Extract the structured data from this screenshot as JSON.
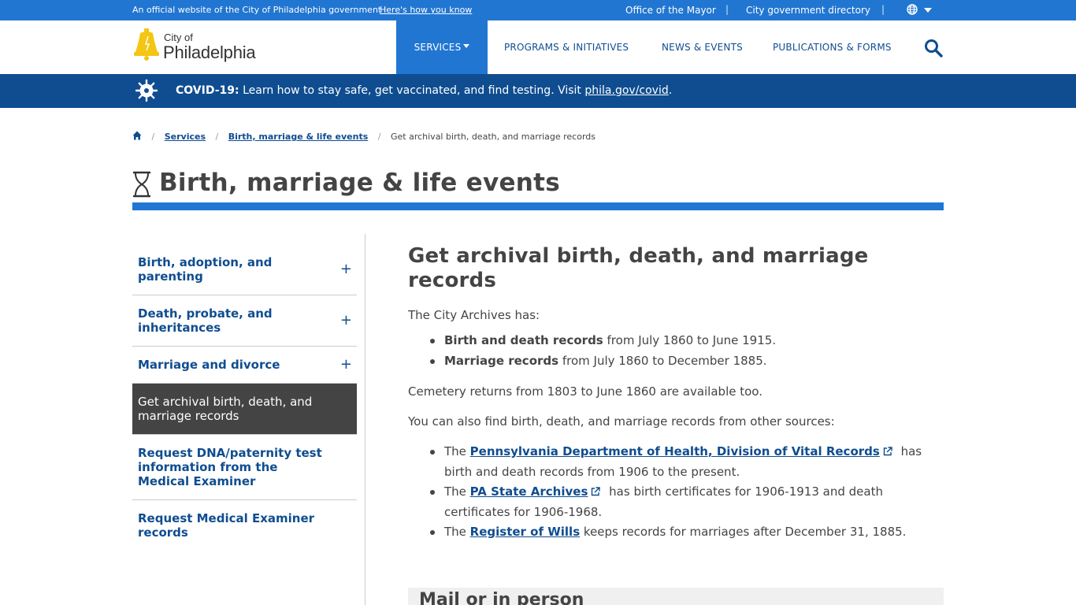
{
  "topbar": {
    "official_text": "An official website of the City of Philadelphia government",
    "how_know": "Here's how you know",
    "links": [
      "Office of the Mayor",
      "City government directory"
    ]
  },
  "header": {
    "logo_city_of": "City of",
    "logo_name": "Philadelphia",
    "nav": [
      "Services",
      "Programs & Initiatives",
      "News & Events",
      "Publications & Forms"
    ]
  },
  "covid": {
    "label": "COVID-19:",
    "message": " Learn how to stay safe, get vaccinated, and find testing. Visit ",
    "link": "phila.gov/covid",
    "end": "."
  },
  "breadcrumb": {
    "items": [
      "Services",
      "Birth, marriage & life events"
    ],
    "current": "Get archival birth, death, and marriage records"
  },
  "page_title": "Birth, marriage & life events",
  "sidenav": [
    {
      "label": "Birth, adoption, and parenting",
      "expandable": true
    },
    {
      "label": "Death, probate, and inheritances",
      "expandable": true
    },
    {
      "label": "Marriage and divorce",
      "expandable": true
    },
    {
      "label": "Get archival birth, death, and marriage records",
      "active": true
    },
    {
      "label": "Request DNA/paternity test information from the Medical Examiner"
    },
    {
      "label": "Request Medical Examiner records"
    }
  ],
  "content": {
    "heading": "Get archival birth, death, and marriage records",
    "intro": "The City Archives has:",
    "has_list": [
      {
        "bold": "Birth and death records",
        "rest": " from July 1860 to June 1915."
      },
      {
        "bold": "Marriage records",
        "rest": " from July 1860 to December 1885."
      }
    ],
    "cemetery": "Cemetery returns from 1803 to June 1860 are available too.",
    "other_sources": "You can also find birth, death, and marriage records from other sources:",
    "sources": [
      {
        "pre": "The ",
        "link": "Pennsylvania Department of Health, Division of Vital Records",
        "external": true,
        "rest": " has birth and death records from 1906 to the present."
      },
      {
        "pre": "The ",
        "link": "PA State Archives",
        "external": true,
        "rest": " has birth certificates for 1906-1913 and death certificates for 1906-1968."
      },
      {
        "pre": "The ",
        "link": "Register of Wills",
        "external": false,
        "rest": " keeps records for marriages after December 31, 1885."
      }
    ],
    "mail_heading": "Mail or in person"
  },
  "colors": {
    "brand_blue": "#2176d2",
    "dark_blue": "#0f4d90",
    "bell_yellow": "#f3c613",
    "active_gray": "#444444"
  }
}
